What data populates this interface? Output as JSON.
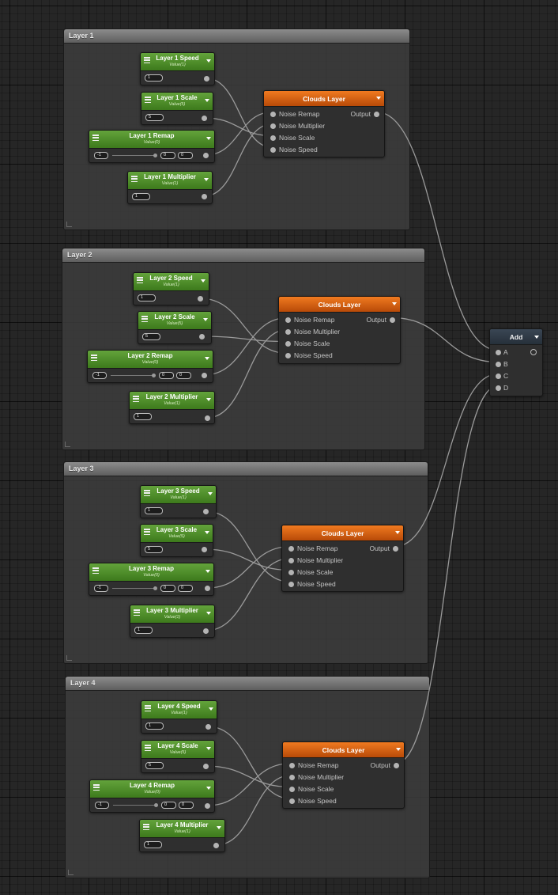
{
  "groups": [
    {
      "title": "Layer 1",
      "speed": {
        "title": "Layer 1 Speed",
        "subtitle": "Value(1)",
        "value": "1"
      },
      "scale": {
        "title": "Layer 1 Scale",
        "subtitle": "Value(5)",
        "value": "5"
      },
      "remap": {
        "title": "Layer 1 Remap",
        "subtitle": "Value(0)",
        "min": "-1",
        "v1": "0",
        "v2": "0"
      },
      "multiplier": {
        "title": "Layer 1 Multiplier",
        "subtitle": "Value(1)",
        "value": "1"
      },
      "clouds": {
        "title": "Clouds Layer",
        "inputs": [
          "Noise Remap",
          "Noise Multiplier",
          "Noise Scale",
          "Noise Speed"
        ],
        "output": "Output"
      }
    },
    {
      "title": "Layer 2",
      "speed": {
        "title": "Layer 2 Speed",
        "subtitle": "Value(1)",
        "value": "1"
      },
      "scale": {
        "title": "Layer 2 Scale",
        "subtitle": "Value(5)",
        "value": "5"
      },
      "remap": {
        "title": "Layer 2 Remap",
        "subtitle": "Value(0)",
        "min": "-1",
        "v1": "0",
        "v2": "0"
      },
      "multiplier": {
        "title": "Layer 2 Multiplier",
        "subtitle": "Value(1)",
        "value": "1"
      },
      "clouds": {
        "title": "Clouds Layer",
        "inputs": [
          "Noise Remap",
          "Noise Multiplier",
          "Noise Scale",
          "Noise Speed"
        ],
        "output": "Output"
      }
    },
    {
      "title": "Layer 3",
      "speed": {
        "title": "Layer 3 Speed",
        "subtitle": "Value(1)",
        "value": "1"
      },
      "scale": {
        "title": "Layer 3 Scale",
        "subtitle": "Value(5)",
        "value": "5"
      },
      "remap": {
        "title": "Layer 3 Remap",
        "subtitle": "Value(0)",
        "min": "-1",
        "v1": "0",
        "v2": "0"
      },
      "multiplier": {
        "title": "Layer 3 Multiplier",
        "subtitle": "Value(1)",
        "value": "1"
      },
      "clouds": {
        "title": "Clouds Layer",
        "inputs": [
          "Noise Remap",
          "Noise Multiplier",
          "Noise Scale",
          "Noise Speed"
        ],
        "output": "Output"
      }
    },
    {
      "title": "Layer 4",
      "speed": {
        "title": "Layer 4 Speed",
        "subtitle": "Value(1)",
        "value": "1"
      },
      "scale": {
        "title": "Layer 4 Scale",
        "subtitle": "Value(5)",
        "value": "5"
      },
      "remap": {
        "title": "Layer 4 Remap",
        "subtitle": "Value(0)",
        "min": "-1",
        "v1": "0",
        "v2": "0"
      },
      "multiplier": {
        "title": "Layer 4 Multiplier",
        "subtitle": "Value(1)",
        "value": "1"
      },
      "clouds": {
        "title": "Clouds Layer",
        "inputs": [
          "Noise Remap",
          "Noise Multiplier",
          "Noise Scale",
          "Noise Speed"
        ],
        "output": "Output"
      }
    }
  ],
  "add": {
    "title": "Add",
    "inputs": [
      "A",
      "B",
      "C",
      "D"
    ]
  },
  "colors": {
    "property_header": "#4e8f2a",
    "clouds_header": "#e06414",
    "add_header": "#2f3a46",
    "wire": "#9a9a9a"
  },
  "icons": {
    "property": "hamburger-icon",
    "dropdown": "caret-down-icon"
  }
}
